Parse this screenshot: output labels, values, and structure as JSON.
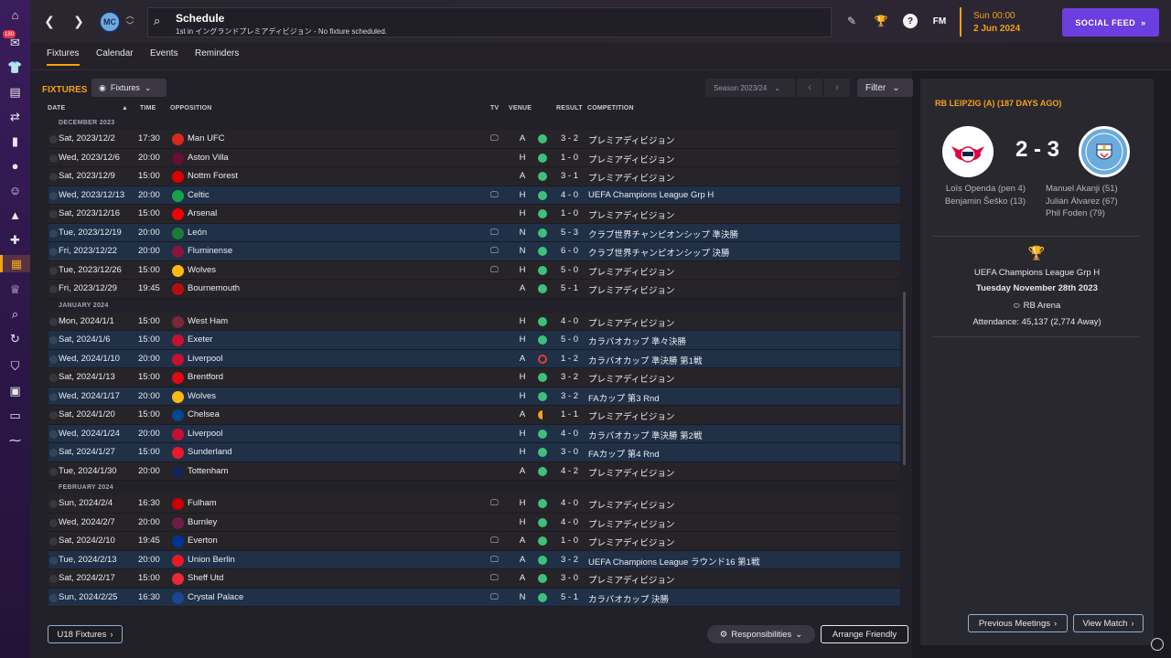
{
  "header": {
    "title": "Schedule",
    "subtitle": "1st in イングランドプレミアディビジョン - No fixture scheduled.",
    "fm_logo": "FM",
    "time": "Sun 00:00",
    "date": "2 Jun 2024",
    "social_feed": "SOCIAL FEED",
    "club_badge": "MC",
    "notification_count": "180"
  },
  "tabs": [
    {
      "label": "Fixtures",
      "active": true
    },
    {
      "label": "Calendar"
    },
    {
      "label": "Events"
    },
    {
      "label": "Reminders"
    }
  ],
  "fixtures": {
    "section_title": "FIXTURES",
    "view_dropdown": "Fixtures",
    "season_dropdown": "Season 2023/24",
    "filter_button": "Filter",
    "columns": {
      "date": "DATE",
      "time": "TIME",
      "opposition": "OPPOSITION",
      "tv": "TV",
      "venue": "VENUE",
      "result": "RESULT",
      "competition": "COMPETITION"
    },
    "months": [
      {
        "label": "DECEMBER 2023",
        "rows": [
          {
            "date": "Sat, 2023/12/2",
            "time": "17:30",
            "opp": "Man UFC",
            "crest": "#da291c",
            "tv": true,
            "venue": "A",
            "result": "win",
            "score": "3 - 2",
            "comp": "プレミアディビジョン",
            "alt": false
          },
          {
            "date": "Wed, 2023/12/6",
            "time": "20:00",
            "opp": "Aston Villa",
            "crest": "#670e36",
            "tv": false,
            "venue": "H",
            "result": "win",
            "score": "1 - 0",
            "comp": "プレミアディビジョン",
            "alt": false
          },
          {
            "date": "Sat, 2023/12/9",
            "time": "15:00",
            "opp": "Nottm Forest",
            "crest": "#dd0000",
            "tv": false,
            "venue": "A",
            "result": "win",
            "score": "3 - 1",
            "comp": "プレミアディビジョン",
            "alt": false
          },
          {
            "date": "Wed, 2023/12/13",
            "time": "20:00",
            "opp": "Celtic",
            "crest": "#16a34a",
            "tv": true,
            "venue": "H",
            "result": "win",
            "score": "4 - 0",
            "comp": "UEFA Champions League Grp H",
            "alt": true
          },
          {
            "date": "Sat, 2023/12/16",
            "time": "15:00",
            "opp": "Arsenal",
            "crest": "#ef0107",
            "tv": false,
            "venue": "H",
            "result": "win",
            "score": "1 - 0",
            "comp": "プレミアディビジョン",
            "alt": false
          },
          {
            "date": "Tue, 2023/12/19",
            "time": "20:00",
            "opp": "León",
            "crest": "#1f7a3a",
            "tv": true,
            "venue": "N",
            "result": "win",
            "score": "5 - 3",
            "comp": "クラブ世界チャンピオンシップ 準決勝",
            "alt": true
          },
          {
            "date": "Fri, 2023/12/22",
            "time": "20:00",
            "opp": "Fluminense",
            "crest": "#8a1538",
            "tv": true,
            "venue": "N",
            "result": "win",
            "score": "6 - 0",
            "comp": "クラブ世界チャンピオンシップ 決勝",
            "alt": true
          },
          {
            "date": "Tue, 2023/12/26",
            "time": "15:00",
            "opp": "Wolves",
            "crest": "#fdb913",
            "tv": true,
            "venue": "H",
            "result": "win",
            "score": "5 - 0",
            "comp": "プレミアディビジョン",
            "alt": false
          },
          {
            "date": "Fri, 2023/12/29",
            "time": "19:45",
            "opp": "Bournemouth",
            "crest": "#b50e12",
            "tv": false,
            "venue": "A",
            "result": "win",
            "score": "5 - 1",
            "comp": "プレミアディビジョン",
            "alt": false
          }
        ]
      },
      {
        "label": "JANUARY 2024",
        "rows": [
          {
            "date": "Mon, 2024/1/1",
            "time": "15:00",
            "opp": "West Ham",
            "crest": "#7a263a",
            "tv": false,
            "venue": "H",
            "result": "win",
            "score": "4 - 0",
            "comp": "プレミアディビジョン",
            "alt": false
          },
          {
            "date": "Sat, 2024/1/6",
            "time": "15:00",
            "opp": "Exeter",
            "crest": "#c8102e",
            "tv": false,
            "venue": "H",
            "result": "win",
            "score": "5 - 0",
            "comp": "カラバオカップ 準々決勝",
            "alt": true
          },
          {
            "date": "Wed, 2024/1/10",
            "time": "20:00",
            "opp": "Liverpool",
            "crest": "#c8102e",
            "tv": false,
            "venue": "A",
            "result": "loss",
            "score": "1 - 2",
            "comp": "カラバオカップ 準決勝 第1戦",
            "alt": true
          },
          {
            "date": "Sat, 2024/1/13",
            "time": "15:00",
            "opp": "Brentford",
            "crest": "#e30613",
            "tv": false,
            "venue": "H",
            "result": "win",
            "score": "3 - 2",
            "comp": "プレミアディビジョン",
            "alt": false
          },
          {
            "date": "Wed, 2024/1/17",
            "time": "20:00",
            "opp": "Wolves",
            "crest": "#fdb913",
            "tv": false,
            "venue": "H",
            "result": "win",
            "score": "3 - 2",
            "comp": "FAカップ 第3 Rnd",
            "alt": true
          },
          {
            "date": "Sat, 2024/1/20",
            "time": "15:00",
            "opp": "Chelsea",
            "crest": "#034694",
            "tv": false,
            "venue": "A",
            "result": "draw",
            "score": "1 - 1",
            "comp": "プレミアディビジョン",
            "alt": false
          },
          {
            "date": "Wed, 2024/1/24",
            "time": "20:00",
            "opp": "Liverpool",
            "crest": "#c8102e",
            "tv": false,
            "venue": "H",
            "result": "win",
            "score": "4 - 0",
            "comp": "カラバオカップ 準決勝 第2戦",
            "alt": true
          },
          {
            "date": "Sat, 2024/1/27",
            "time": "15:00",
            "opp": "Sunderland",
            "crest": "#eb172b",
            "tv": false,
            "venue": "H",
            "result": "win",
            "score": "3 - 0",
            "comp": "FAカップ 第4 Rnd",
            "alt": true
          },
          {
            "date": "Tue, 2024/1/30",
            "time": "20:00",
            "opp": "Tottenham",
            "crest": "#132257",
            "tv": false,
            "venue": "A",
            "result": "win",
            "score": "4 - 2",
            "comp": "プレミアディビジョン",
            "alt": false
          }
        ]
      },
      {
        "label": "FEBRUARY 2024",
        "rows": [
          {
            "date": "Sun, 2024/2/4",
            "time": "16:30",
            "opp": "Fulham",
            "crest": "#cc0000",
            "tv": true,
            "venue": "H",
            "result": "win",
            "score": "4 - 0",
            "comp": "プレミアディビジョン",
            "alt": false
          },
          {
            "date": "Wed, 2024/2/7",
            "time": "20:00",
            "opp": "Burnley",
            "crest": "#6c1d45",
            "tv": false,
            "venue": "H",
            "result": "win",
            "score": "4 - 0",
            "comp": "プレミアディビジョン",
            "alt": false
          },
          {
            "date": "Sat, 2024/2/10",
            "time": "19:45",
            "opp": "Everton",
            "crest": "#003399",
            "tv": true,
            "venue": "A",
            "result": "win",
            "score": "1 - 0",
            "comp": "プレミアディビジョン",
            "alt": false
          },
          {
            "date": "Tue, 2024/2/13",
            "time": "20:00",
            "opp": "Union Berlin",
            "crest": "#eb1923",
            "tv": true,
            "venue": "A",
            "result": "win",
            "score": "3 - 2",
            "comp": "UEFA Champions League ラウンド16 第1戦",
            "alt": true
          },
          {
            "date": "Sat, 2024/2/17",
            "time": "15:00",
            "opp": "Sheff Utd",
            "crest": "#ee2737",
            "tv": true,
            "venue": "A",
            "result": "win",
            "score": "3 - 0",
            "comp": "プレミアディビジョン",
            "alt": false
          },
          {
            "date": "Sun, 2024/2/25",
            "time": "16:30",
            "opp": "Crystal Palace",
            "crest": "#1b458f",
            "tv": true,
            "venue": "N",
            "result": "win",
            "score": "5 - 1",
            "comp": "カラバオカップ 決勝",
            "alt": true
          }
        ]
      }
    ],
    "u18_button": "U18 Fixtures",
    "responsibilities_button": "Responsibilities",
    "arrange_friendly_button": "Arrange Friendly"
  },
  "match_panel": {
    "title": "RB LEIPZIG (A) (187 DAYS AGO)",
    "score": "2 - 3",
    "home_scorers": [
      "Loïs Openda (pen 4)",
      "Benjamin Šeško (13)"
    ],
    "away_scorers": [
      "Manuel Akanji (51)",
      "Julián Álvarez (67)",
      "Phil Foden (79)"
    ],
    "competition": "UEFA Champions League Grp H",
    "match_date": "Tuesday November 28th 2023",
    "stadium": "RB Arena",
    "attendance": "Attendance: 45,137 (2,774 Away)",
    "previous_meetings_button": "Previous Meetings",
    "view_match_button": "View Match",
    "away_crest_text": "MANCHESTER CITY"
  },
  "colors": {
    "accent": "#f3a21a",
    "social": "#6b3ee0",
    "win": "#3ec07b",
    "loss": "#e03b3b"
  }
}
